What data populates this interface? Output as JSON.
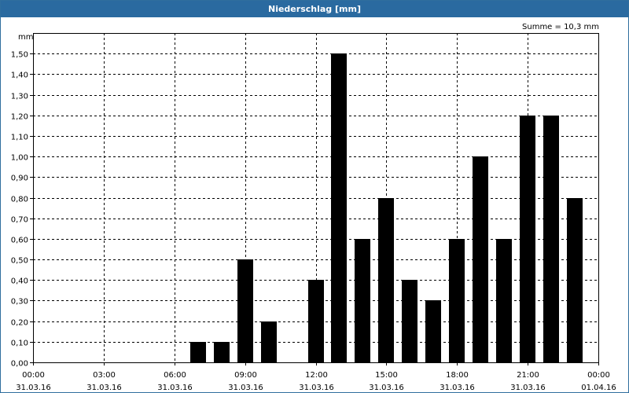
{
  "window": {
    "title": "Niederschlag [mm]"
  },
  "chart_data": {
    "type": "bar",
    "title": "Niederschlag [mm]",
    "ylabel": "mm",
    "annotation": "Summe = 10,3 mm",
    "ylim": [
      0,
      1.6
    ],
    "yticks": [
      "0,00",
      "0,10",
      "0,20",
      "0,30",
      "0,40",
      "0,50",
      "0,60",
      "0,70",
      "0,80",
      "0,90",
      "1,00",
      "1,10",
      "1,20",
      "1,30",
      "1,40",
      "1,50"
    ],
    "xlim_hours": [
      0,
      24
    ],
    "xticks": [
      {
        "time": "00:00",
        "date": "31.03.16"
      },
      {
        "time": "03:00",
        "date": "31.03.16"
      },
      {
        "time": "06:00",
        "date": "31.03.16"
      },
      {
        "time": "09:00",
        "date": "31.03.16"
      },
      {
        "time": "12:00",
        "date": "31.03.16"
      },
      {
        "time": "15:00",
        "date": "31.03.16"
      },
      {
        "time": "18:00",
        "date": "31.03.16"
      },
      {
        "time": "21:00",
        "date": "31.03.16"
      },
      {
        "time": "00:00",
        "date": "01.04.16"
      }
    ],
    "bars": [
      {
        "hour": "07:00",
        "value": 0.1
      },
      {
        "hour": "08:00",
        "value": 0.1
      },
      {
        "hour": "09:00",
        "value": 0.5
      },
      {
        "hour": "10:00",
        "value": 0.2
      },
      {
        "hour": "12:00",
        "value": 0.4
      },
      {
        "hour": "13:00",
        "value": 1.5
      },
      {
        "hour": "14:00",
        "value": 0.6
      },
      {
        "hour": "15:00",
        "value": 0.8
      },
      {
        "hour": "16:00",
        "value": 0.4
      },
      {
        "hour": "17:00",
        "value": 0.3
      },
      {
        "hour": "18:00",
        "value": 0.6
      },
      {
        "hour": "19:00",
        "value": 1.0
      },
      {
        "hour": "20:00",
        "value": 0.6
      },
      {
        "hour": "21:00",
        "value": 1.2
      },
      {
        "hour": "22:00",
        "value": 1.2
      },
      {
        "hour": "23:00",
        "value": 0.8
      }
    ],
    "grid": true,
    "colors": {
      "bar": "#000000",
      "titlebar": "#2a6aa0",
      "grid": "#000000"
    }
  }
}
